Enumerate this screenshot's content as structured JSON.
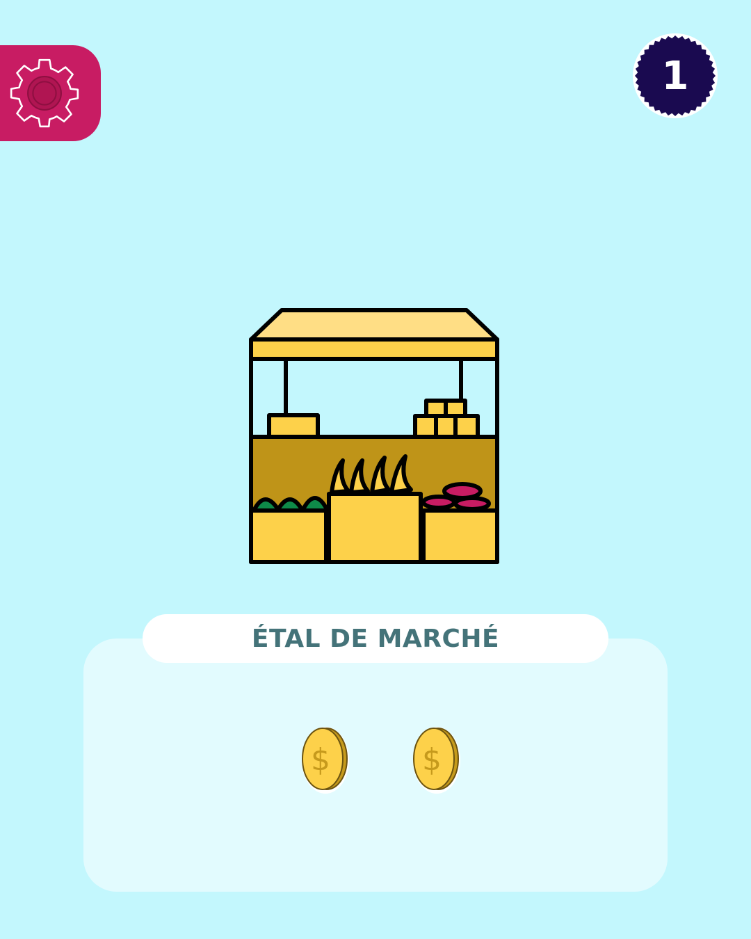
{
  "level": {
    "number": "1",
    "badge_color": "#1a0a50"
  },
  "settings": {
    "icon": "gear-icon",
    "color": "#c81c63"
  },
  "item": {
    "name": "ÉTAL DE MARCHÉ",
    "image": "market-stall-illustration"
  },
  "price": {
    "coin_count": 2,
    "coin_icon": "dollar-coin-icon",
    "coin_color": "#fdd14a"
  },
  "colors": {
    "background": "#c3f7fd",
    "panel": "#e2fbfe",
    "title_text": "#447379"
  }
}
